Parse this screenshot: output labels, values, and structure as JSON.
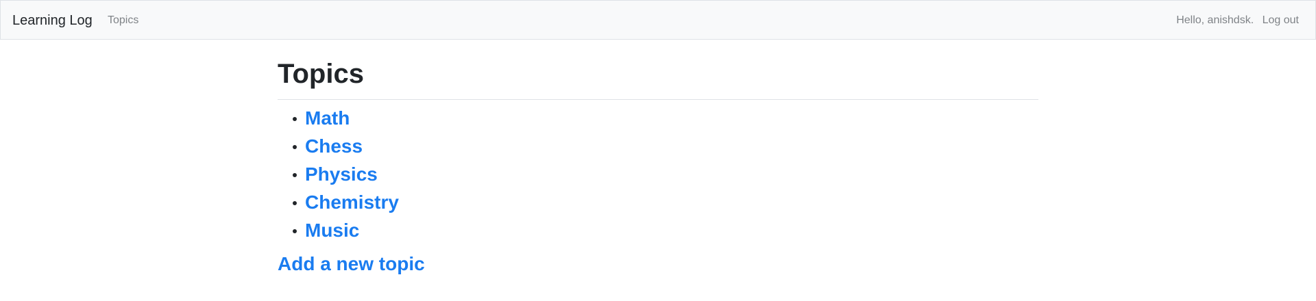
{
  "navbar": {
    "brand": "Learning Log",
    "topics_link": "Topics",
    "greeting": "Hello, anishdsk.",
    "logout": "Log out"
  },
  "main": {
    "title": "Topics",
    "topics": [
      {
        "label": "Math"
      },
      {
        "label": "Chess"
      },
      {
        "label": "Physics"
      },
      {
        "label": "Chemistry"
      },
      {
        "label": "Music"
      }
    ],
    "add_topic": "Add a new topic"
  },
  "colors": {
    "link": "#1a7cf0",
    "navbar_bg": "#f8f9fa",
    "nav_text": "#7f8387",
    "heading": "#212529"
  }
}
